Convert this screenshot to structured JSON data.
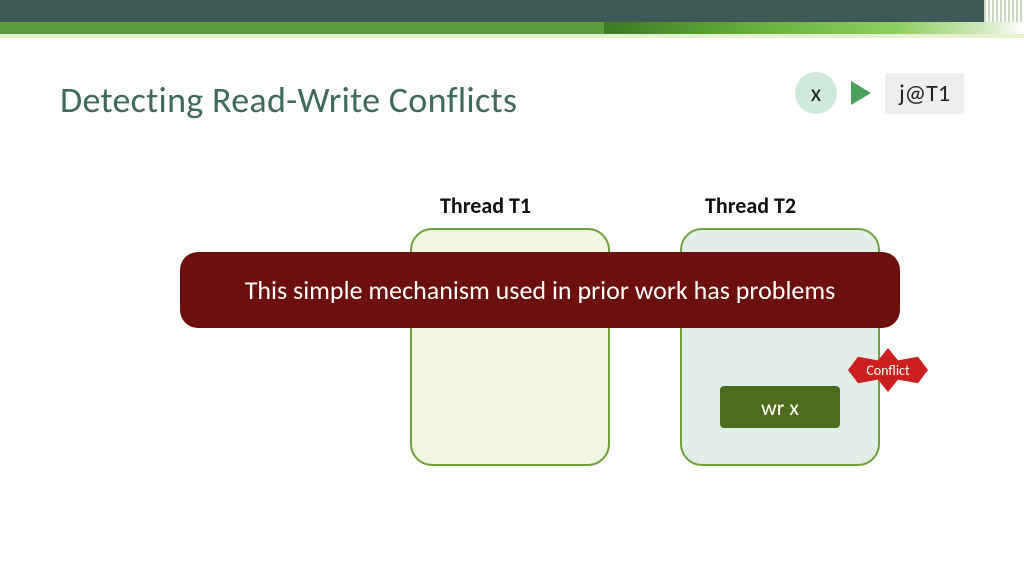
{
  "title": "Detecting Read-Write Conflicts",
  "legend": {
    "var": "x",
    "label": "j@T1"
  },
  "columns": {
    "t1": "Thread T1",
    "t2": "Thread T2"
  },
  "callout": "This simple mechanism used in prior work has problems",
  "action": {
    "wr": "wr x"
  },
  "conflict": "Conflict"
}
